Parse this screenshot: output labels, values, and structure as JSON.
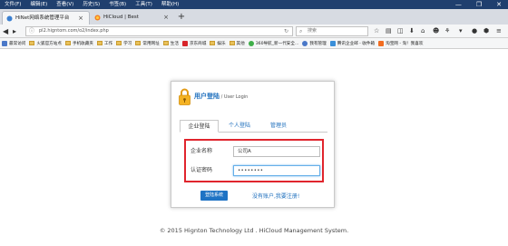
{
  "menubar": {
    "items": [
      "文件(F)",
      "编辑(E)",
      "查看(V)",
      "历史(S)",
      "书签(B)",
      "工具(T)",
      "帮助(H)"
    ],
    "window_controls": [
      "—",
      "❐",
      "✕"
    ]
  },
  "tabs": [
    {
      "title": "HiNet网络系统管理平台",
      "favicon": "hinet-favicon",
      "active": true
    },
    {
      "title": "HiCloud | Best",
      "favicon": "firefox-favicon",
      "active": false
    }
  ],
  "nav": {
    "url": "pl2.higntom.com/o2/index.php",
    "search_placeholder": "搜索"
  },
  "bookmarks": [
    {
      "label": "最常访问",
      "icon": "star-icon",
      "color": "#4a78c8"
    },
    {
      "label": "火狐官方站点",
      "icon": "folder",
      "color": "#e8c15a"
    },
    {
      "label": "手机收藏夹",
      "icon": "folder",
      "color": "#e8c15a"
    },
    {
      "label": "工作",
      "icon": "folder",
      "color": "#e8c15a"
    },
    {
      "label": "学习",
      "icon": "folder",
      "color": "#e8c15a"
    },
    {
      "label": "常用网址",
      "icon": "folder",
      "color": "#e8c15a"
    },
    {
      "label": "生活",
      "icon": "folder",
      "color": "#e8c15a"
    },
    {
      "label": "京东商城",
      "icon": "jd-icon",
      "color": "#d8252b"
    },
    {
      "label": "娱乐",
      "icon": "folder",
      "color": "#e8c15a"
    },
    {
      "label": "其他",
      "icon": "folder",
      "color": "#e8c15a"
    },
    {
      "label": "360导航_新一代安全...",
      "icon": "360-icon",
      "color": "#3fae49"
    },
    {
      "label": "我有管理",
      "icon": "globe-icon",
      "color": "#4a78c8"
    },
    {
      "label": "腾讯企业邮 - 收件箱",
      "icon": "mail-icon",
      "color": "#3a8fd9"
    },
    {
      "label": "淘宝网 - 淘！我喜欢",
      "icon": "taobao-icon",
      "color": "#f26d21"
    }
  ],
  "login": {
    "title_cn": "用户登陆",
    "title_sep": " / ",
    "title_en": "User Login",
    "tabs": [
      "企业登陆",
      "个人登陆",
      "管理员"
    ],
    "company_label": "企业名称",
    "company_value": "公司A",
    "password_label": "认证密码",
    "password_value": "••••••••",
    "login_button": "登陆系统",
    "register_link": "没有账户,我要注册!"
  },
  "footer": {
    "text": "© 2015 Hignton Technology Ltd . HiCloud Management System."
  },
  "colors": {
    "accent": "#1e73c4",
    "highlight_border": "#e0252d",
    "menubar_bg": "#1f3f6e"
  }
}
